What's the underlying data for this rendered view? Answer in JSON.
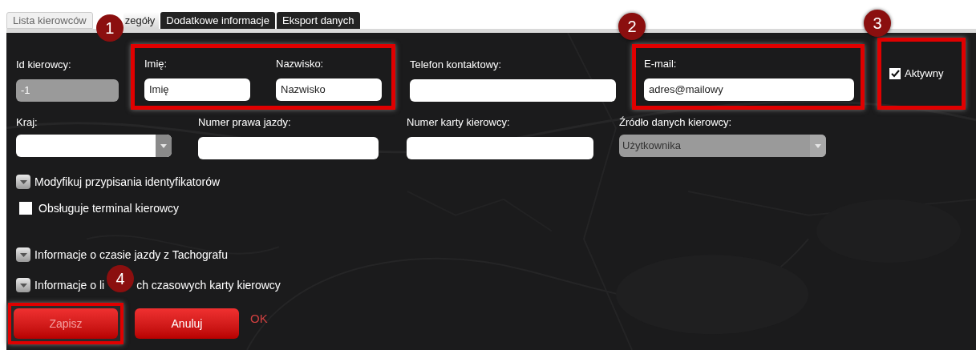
{
  "tabs": [
    {
      "label": "Lista kierowców",
      "selected": false
    },
    {
      "label": "zegóły",
      "selected": true,
      "badge": "1"
    },
    {
      "label": "Dodatkowe informacje",
      "selected": false
    },
    {
      "label": "Eksport danych",
      "selected": false
    }
  ],
  "id_field": {
    "label": "Id kierowcy:",
    "value": "-1",
    "disabled": true
  },
  "name_group": {
    "fields": [
      {
        "label": "Imię:",
        "value": "Imię"
      },
      {
        "label": "Nazwisko:",
        "value": "Nazwisko"
      }
    ]
  },
  "phone_field": {
    "label": "Telefon kontaktowy:"
  },
  "email_group": {
    "badge": "2",
    "label": "E-mail:",
    "value": "adres@mailowy"
  },
  "active_group": {
    "badge": "3",
    "label": "Aktywny",
    "checked": true
  },
  "row2": [
    {
      "kind": "dropdown",
      "label": "Kraj:",
      "disabled": false
    },
    {
      "kind": "text",
      "label": "Numer prawa jazdy:"
    },
    {
      "kind": "text",
      "label": "Numer karty kierowcy:"
    },
    {
      "kind": "dropdown",
      "label": "Źródło danych kierowcy:",
      "value": "Użytkownika",
      "disabled": true
    }
  ],
  "sections": [
    {
      "kind": "expander",
      "label": "Modyfikuj przypisania identyfikatorów"
    },
    {
      "kind": "checkbox",
      "label": "Obsługuje terminal kierowcy",
      "checked": false
    },
    {
      "kind": "expander",
      "label": "Informacje o czasie jazdy z Tachografu"
    },
    {
      "kind": "expander",
      "label": "Informacje o li",
      "label_after_badge": "ch czasowych karty kierowcy",
      "badge": "4"
    }
  ],
  "buttons": [
    {
      "label": "Zapisz",
      "disabled": true,
      "highlighted": true
    },
    {
      "label": "Anuluj",
      "disabled": false,
      "highlighted": false
    }
  ],
  "status": "OK"
}
